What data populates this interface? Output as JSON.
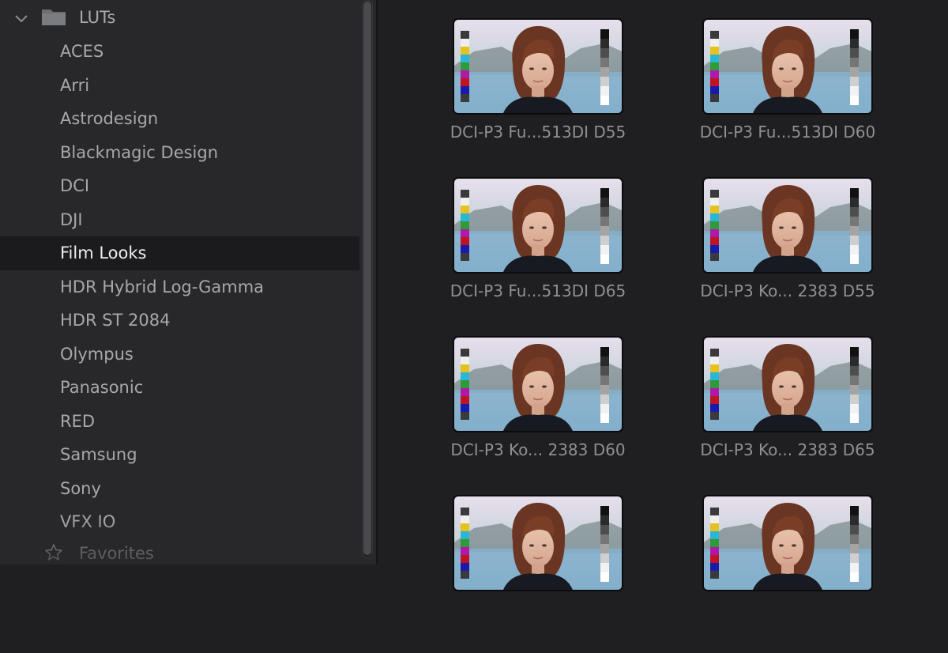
{
  "sidebar": {
    "root": {
      "label": "LUTs",
      "icon": "folder-icon",
      "expand_icon": "chevron-down-icon"
    },
    "items": [
      {
        "label": "ACES"
      },
      {
        "label": "Arri"
      },
      {
        "label": "Astrodesign"
      },
      {
        "label": "Blackmagic Design"
      },
      {
        "label": "DCI"
      },
      {
        "label": "DJI"
      },
      {
        "label": "Film Looks",
        "selected": true
      },
      {
        "label": "HDR Hybrid Log-Gamma"
      },
      {
        "label": "HDR ST 2084"
      },
      {
        "label": "Olympus"
      },
      {
        "label": "Panasonic"
      },
      {
        "label": "RED"
      },
      {
        "label": "Samsung"
      },
      {
        "label": "Sony"
      },
      {
        "label": "VFX IO"
      }
    ],
    "favorites": {
      "label": "Favorites",
      "icon": "star-icon"
    }
  },
  "luts": [
    {
      "name": "DCI-P3 Fu...513DI D55"
    },
    {
      "name": "DCI-P3 Fu...513DI D60"
    },
    {
      "name": "DCI-P3 Fu...513DI D65"
    },
    {
      "name": "DCI-P3 Ko... 2383 D55"
    },
    {
      "name": "DCI-P3 Ko... 2383 D60"
    },
    {
      "name": "DCI-P3 Ko... 2383 D65"
    },
    {
      "name": ""
    },
    {
      "name": ""
    }
  ],
  "colors": {
    "sidebar_bg": "#28282b",
    "selected_bg": "#1b1b1e",
    "content_bg": "#1f1f22"
  }
}
